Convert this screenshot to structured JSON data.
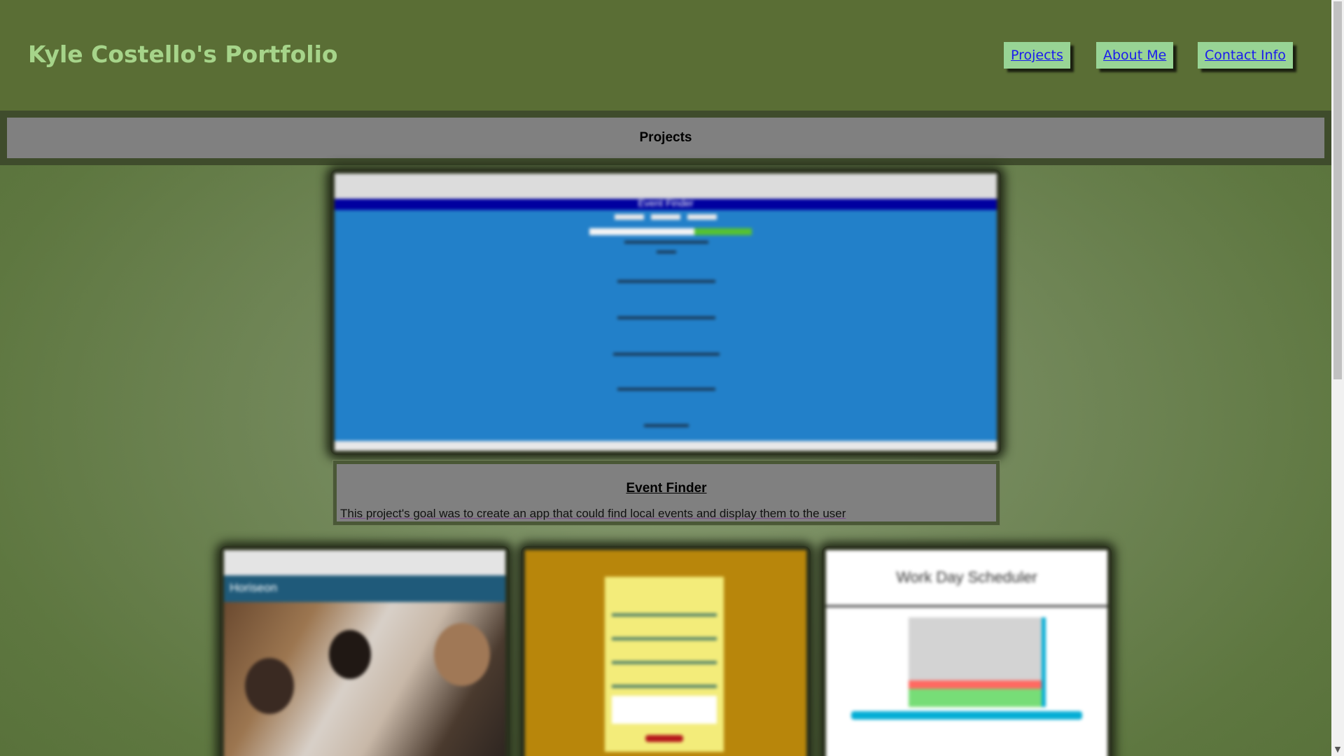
{
  "header": {
    "title": "Kyle Costello's Portfolio",
    "nav": [
      {
        "label": "Projects"
      },
      {
        "label": "About Me"
      },
      {
        "label": "Contact Info"
      }
    ]
  },
  "section": {
    "title": "Projects"
  },
  "featured_project": {
    "title": "Event Finder",
    "description": "This project's goal was to create an app that could find local events and display them to the user",
    "screenshot_heading": "Event Finder"
  },
  "project_thumbnails": {
    "office_site_brand": "Horiseon",
    "scheduler_title": "Work Day Scheduler"
  },
  "colors": {
    "header_bg": "#5a6e35",
    "title_color": "#a6d48a",
    "nav_button_bg": "#98d495",
    "section_bar_bg": "#808080"
  }
}
